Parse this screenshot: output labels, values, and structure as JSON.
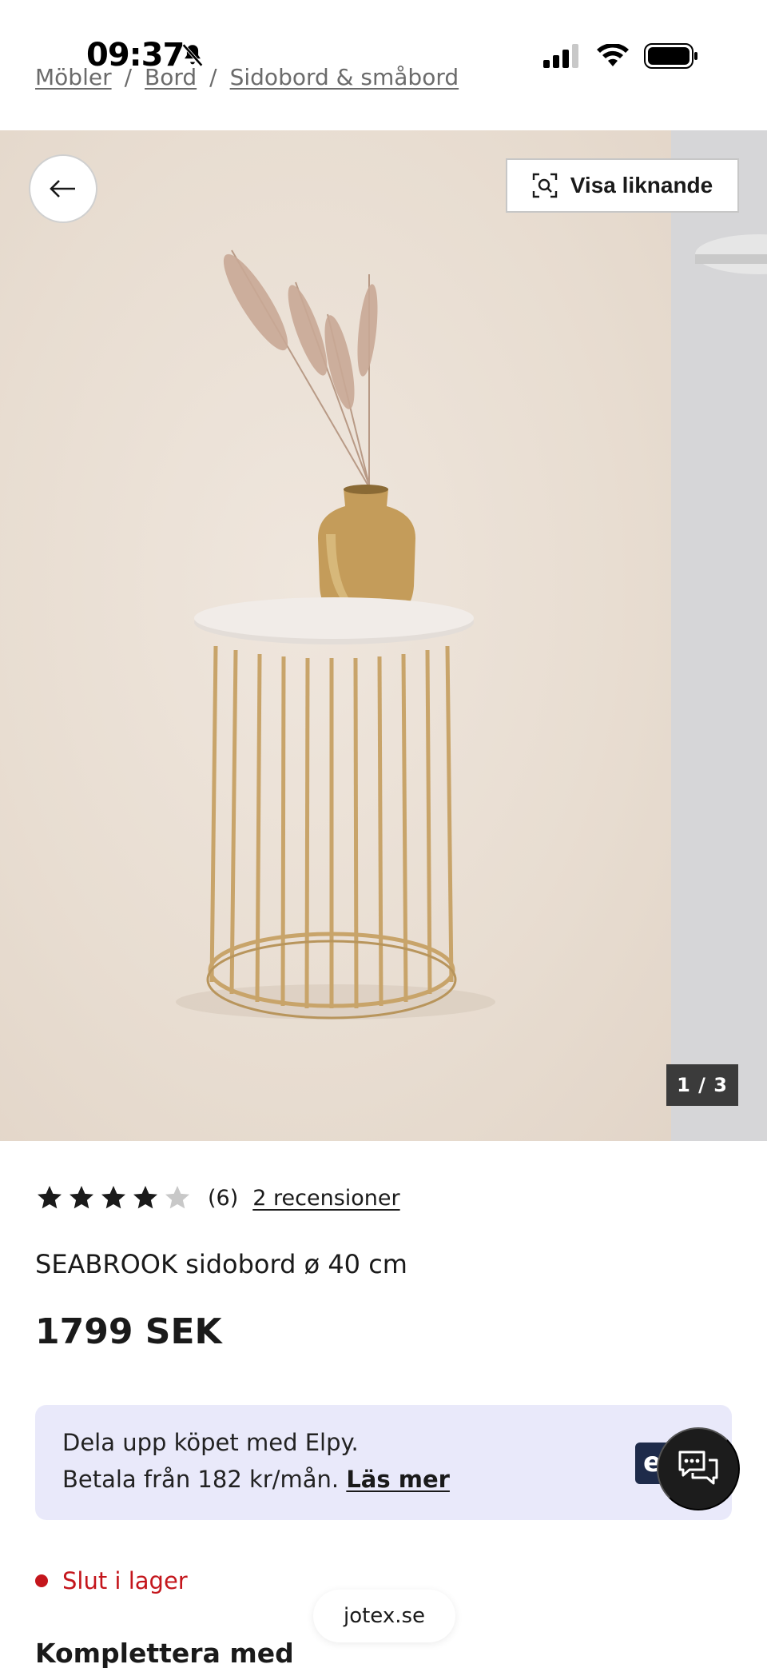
{
  "status_bar": {
    "time": "09:37"
  },
  "breadcrumb": {
    "items": [
      "Möbler",
      "Bord",
      "Sidobord & småbord"
    ],
    "separator": "/"
  },
  "gallery": {
    "similar_label": "Visa liknande",
    "counter": "1 / 3",
    "current": 1,
    "total": 3
  },
  "product": {
    "rating": 4,
    "rating_max": 5,
    "rating_count": "(6)",
    "reviews_label": "2 recensioner",
    "title": "SEABROOK sidobord ø 40 cm",
    "price": "1799 SEK"
  },
  "elpy": {
    "line1": "Dela upp köpet med Elpy.",
    "line2": "Betala från 182 kr/mån.",
    "link": "Läs mer",
    "logo_text": "e"
  },
  "stock": {
    "label": "Slut i lager",
    "color": "#c4161c"
  },
  "section": {
    "complement_title": "Komplettera med"
  },
  "browser": {
    "url": "jotex.se"
  },
  "icons": {
    "back": "arrow-left-icon",
    "similar": "visual-search-icon",
    "chat": "chat-bubbles-icon",
    "bell": "bell-off-icon"
  }
}
